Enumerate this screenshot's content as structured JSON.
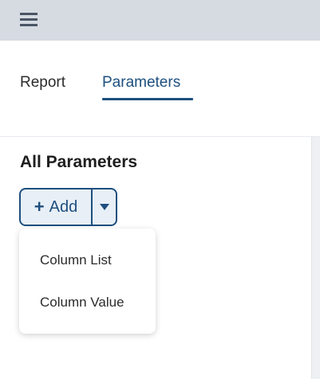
{
  "header": {
    "menu_icon": "hamburger-icon"
  },
  "tabs": [
    {
      "label": "Report",
      "active": false
    },
    {
      "label": "Parameters",
      "active": true
    }
  ],
  "section": {
    "title": "All Parameters"
  },
  "add_button": {
    "label": "Add",
    "plus_icon": "plus-icon",
    "caret_icon": "chevron-down-icon"
  },
  "dropdown": {
    "items": [
      {
        "label": "Column List"
      },
      {
        "label": "Column Value"
      }
    ]
  },
  "colors": {
    "accent": "#1d4f7e",
    "topbar": "#d5dbe1",
    "button_bg": "#e8eff6"
  }
}
